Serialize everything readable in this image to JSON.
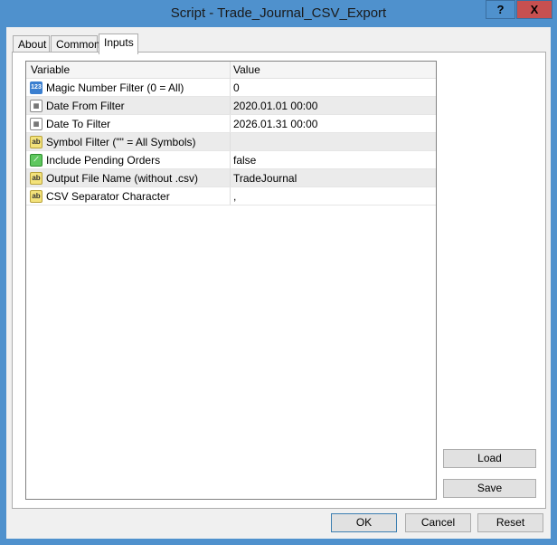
{
  "window": {
    "title": "Script - Trade_Journal_CSV_Export",
    "help_label": "?",
    "close_label": "X"
  },
  "tabs": [
    {
      "label": "About"
    },
    {
      "label": "Common"
    },
    {
      "label": "Inputs",
      "active": true
    }
  ],
  "grid": {
    "headers": {
      "variable": "Variable",
      "value": "Value"
    },
    "rows": [
      {
        "icon": "integer-icon",
        "icon_text": "123",
        "variable": "Magic Number Filter (0 = All)",
        "value": "0"
      },
      {
        "icon": "datetime-icon",
        "icon_text": "",
        "variable": "Date From Filter",
        "value": "2020.01.01 00:00"
      },
      {
        "icon": "datetime-icon",
        "icon_text": "",
        "variable": "Date To Filter",
        "value": "2026.01.31 00:00"
      },
      {
        "icon": "string-icon",
        "icon_text": "ab",
        "variable": "Symbol Filter (\"\" = All Symbols)",
        "value": ""
      },
      {
        "icon": "bool-icon",
        "icon_text": "",
        "variable": "Include Pending Orders",
        "value": "false"
      },
      {
        "icon": "string-icon",
        "icon_text": "ab",
        "variable": "Output File Name (without .csv)",
        "value": "TradeJournal"
      },
      {
        "icon": "string-icon",
        "icon_text": "ab",
        "variable": "CSV Separator Character",
        "value": ","
      }
    ]
  },
  "buttons": {
    "load": "Load",
    "save": "Save",
    "ok": "OK",
    "cancel": "Cancel",
    "reset": "Reset"
  }
}
